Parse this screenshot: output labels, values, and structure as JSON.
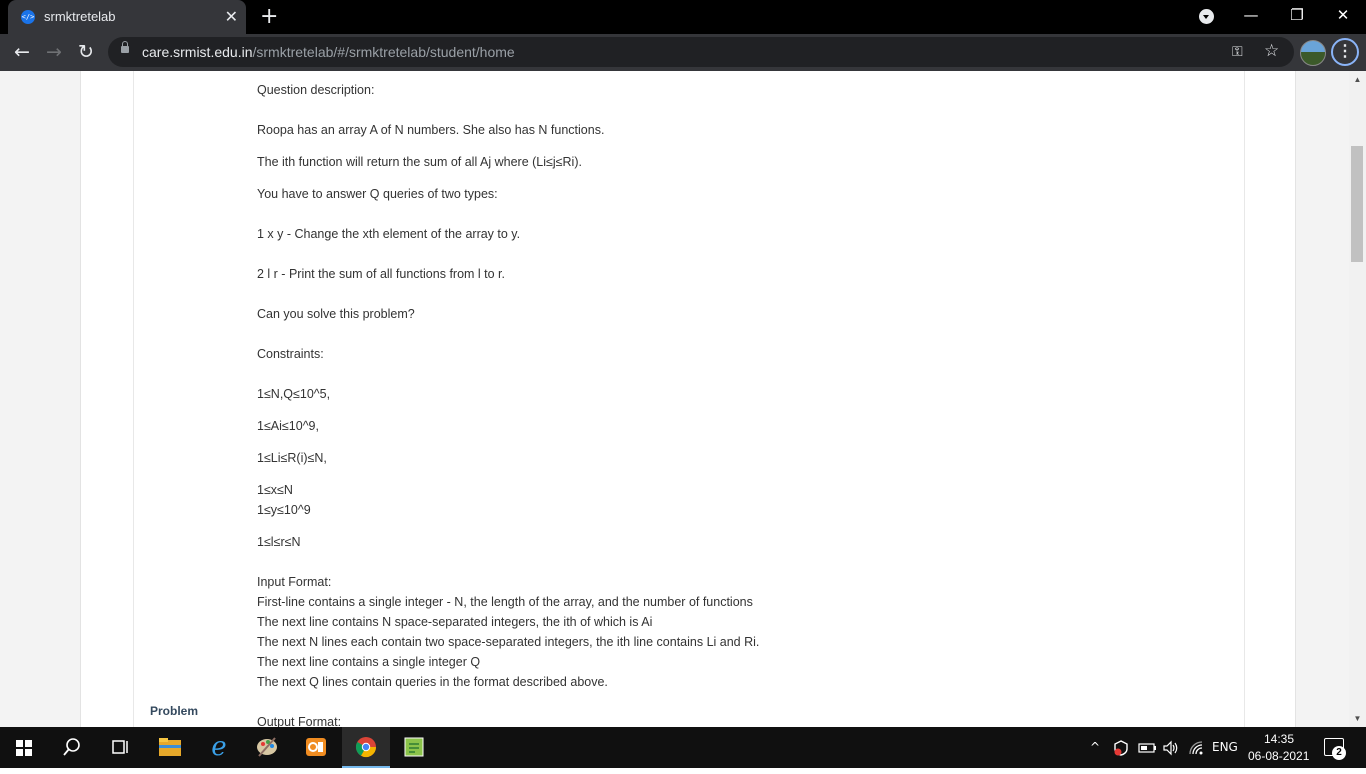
{
  "browser": {
    "tab_title": "srmktretelab",
    "favicon_glyph": "</>",
    "tab_close": "✕",
    "new_tab": "+",
    "url_host": "care.srmist.edu.in",
    "url_path": "/srmktretelab/#/srmktretelab/student/home",
    "window_controls": {
      "minimize": "—",
      "restore": "❐",
      "close": "✕"
    },
    "nav": {
      "back": "←",
      "forward": "→",
      "reload": "↻"
    },
    "icons": {
      "key": "⚿",
      "star": "☆",
      "menu": "⋮"
    }
  },
  "page": {
    "side_label": "Problem",
    "lines": [
      "Question description:",
      "Roopa has an array A of N numbers. She also has N functions.",
      "The ith function will return the sum of all Aj where (Li≤j≤Ri).",
      "You have to answer Q queries of two types:",
      "1 x y - Change the xth element of the array to y.",
      " 2 l r - Print the sum of all functions from l to r.",
      "Can you solve this problem?",
      "Constraints:",
      "1≤N,Q≤10^5,",
      "1≤Ai≤10^9,",
      "1≤Li≤R(i)≤N,",
      "1≤x≤N",
      "1≤y≤10^9",
      "1≤l≤r≤N",
      "Input Format:",
      "First-line contains a single integer - N, the length of the array, and the number of functions",
      "The next line contains N space-separated integers, the ith of which is Ai",
      "The next N lines each contain two space-separated integers, the ith line contains Li and Ri.",
      "The next line contains a single integer Q",
      "The next Q lines contain queries in the format described above.",
      "Output Format:"
    ]
  },
  "taskbar": {
    "lang": "ENG",
    "time": "14:35",
    "date": "06-08-2021",
    "notification_count": "2",
    "tray_chevron": "^"
  }
}
